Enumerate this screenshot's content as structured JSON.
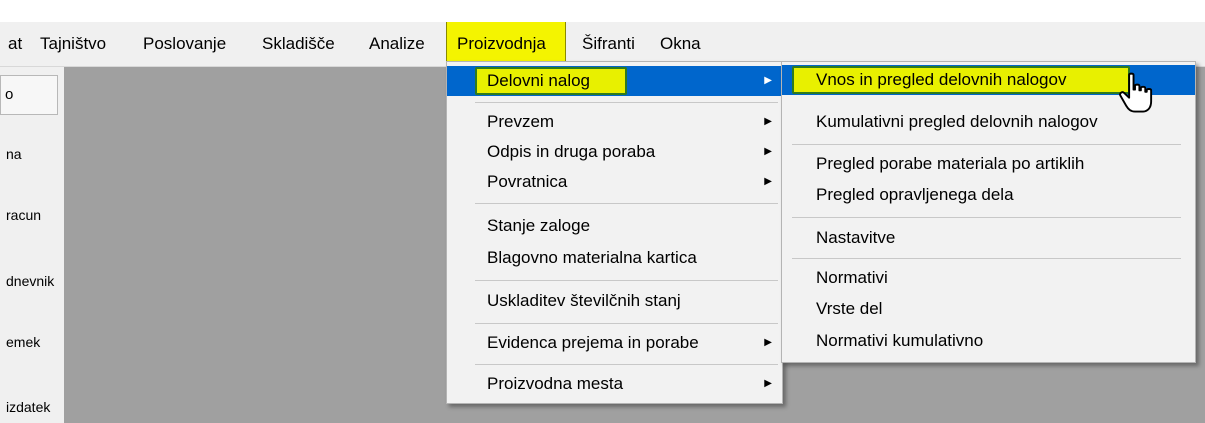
{
  "menubar": {
    "items": [
      {
        "label": "at"
      },
      {
        "label": "Tajništvo"
      },
      {
        "label": "Poslovanje"
      },
      {
        "label": "Skladišče"
      },
      {
        "label": "Analize"
      },
      {
        "label": "Proizvodnja"
      },
      {
        "label": "Šifranti"
      },
      {
        "label": "Okna"
      }
    ]
  },
  "sidebar": {
    "header": "o",
    "items": [
      {
        "label": "na"
      },
      {
        "label": "racun"
      },
      {
        "label": "dnevnik"
      },
      {
        "label": "emek"
      },
      {
        "label": "izdatek"
      }
    ]
  },
  "proizvodnja_menu": {
    "items": [
      {
        "label": "Delovni nalog",
        "submenu": true
      },
      {
        "label": "Prevzem",
        "submenu": true
      },
      {
        "label": "Odpis in druga poraba",
        "submenu": true
      },
      {
        "label": "Povratnica",
        "submenu": true
      },
      {
        "label": "Stanje zaloge"
      },
      {
        "label": "Blagovno materialna kartica"
      },
      {
        "label": "Uskladitev številčnih stanj"
      },
      {
        "label": "Evidenca prejema in porabe",
        "submenu": true
      },
      {
        "label": "Proizvodna mesta",
        "submenu": true
      }
    ]
  },
  "delovni_nalog_menu": {
    "items": [
      {
        "label": "Vnos in pregled delovnih nalogov"
      },
      {
        "label": "Kumulativni pregled delovnih nalogov"
      },
      {
        "label": "Pregled porabe materiala po artiklih"
      },
      {
        "label": "Pregled opravljenega dela"
      },
      {
        "label": "Nastavitve"
      },
      {
        "label": "Normativi"
      },
      {
        "label": "Vrste del"
      },
      {
        "label": "Normativi kumulativno"
      }
    ]
  },
  "colors": {
    "selection": "#0066cc",
    "highlight": "#e8f000",
    "highlight_border": "#2f7a1e",
    "workspace": "#a0a0a0"
  },
  "icons": {
    "submenu_arrow": "triangle-right",
    "cursor": "hand-pointer"
  }
}
